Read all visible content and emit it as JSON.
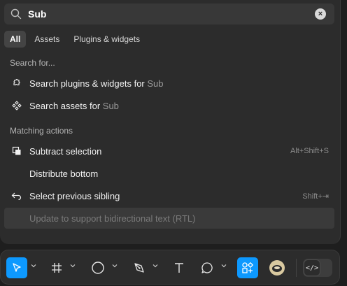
{
  "search": {
    "value": "Sub",
    "clear_label": "×"
  },
  "tabs": [
    {
      "label": "All",
      "active": true
    },
    {
      "label": "Assets"
    },
    {
      "label": "Plugins & widgets"
    }
  ],
  "sections": {
    "search_for": "Search for...",
    "matching_actions": "Matching actions"
  },
  "search_for_items": [
    {
      "label": "Search plugins & widgets for ",
      "query": "Sub",
      "icon": "plugin-icon"
    },
    {
      "label": "Search assets for ",
      "query": "Sub",
      "icon": "component-icon"
    }
  ],
  "actions": [
    {
      "label": "Subtract selection",
      "shortcut": "Alt+Shift+S",
      "icon": "subtract-icon"
    },
    {
      "label": "Distribute bottom",
      "shortcut": "",
      "icon": ""
    },
    {
      "label": "Select previous sibling",
      "shortcut": "Shift+⇥",
      "icon": "return-arrow-icon"
    },
    {
      "label": "Update to support bidirectional text (RTL)",
      "shortcut": "",
      "icon": "",
      "disabled": true
    }
  ],
  "toolbar": {
    "tools": [
      "move-tool",
      "frame-tool",
      "ellipse-tool",
      "pen-tool",
      "text-tool",
      "comment-tool",
      "actions-tool",
      "plugin-avatar"
    ],
    "accent_color": "#0d99ff",
    "dev_mode_label": "</>"
  }
}
